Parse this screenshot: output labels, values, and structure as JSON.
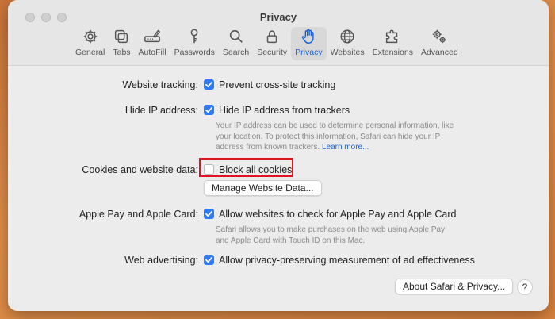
{
  "window": {
    "title": "Privacy"
  },
  "toolbar": {
    "tabs": [
      {
        "label": "General",
        "icon": "gear-icon"
      },
      {
        "label": "Tabs",
        "icon": "tabs-icon"
      },
      {
        "label": "AutoFill",
        "icon": "pencil-icon"
      },
      {
        "label": "Passwords",
        "icon": "key-icon"
      },
      {
        "label": "Search",
        "icon": "search-icon"
      },
      {
        "label": "Security",
        "icon": "lock-icon"
      },
      {
        "label": "Privacy",
        "icon": "hand-icon",
        "active": true
      },
      {
        "label": "Websites",
        "icon": "globe-icon"
      },
      {
        "label": "Extensions",
        "icon": "puzzle-icon"
      },
      {
        "label": "Advanced",
        "icon": "gears-icon"
      }
    ]
  },
  "settings": {
    "tracking": {
      "label": "Website tracking:",
      "option": "Prevent cross-site tracking",
      "checked": true
    },
    "hide_ip": {
      "label": "Hide IP address:",
      "option": "Hide IP address from trackers",
      "checked": true,
      "desc_line1": "Your IP address can be used to determine personal information, like",
      "desc_line2": "your location. To protect this information, Safari can hide your IP",
      "desc_line3": "address from known trackers.",
      "learn_more": "Learn more..."
    },
    "cookies": {
      "label": "Cookies and website data:",
      "option": "Block all cookies",
      "checked": false,
      "manage_button": "Manage Website Data..."
    },
    "apple_pay": {
      "label": "Apple Pay and Apple Card:",
      "option": "Allow websites to check for Apple Pay and Apple Card",
      "checked": true,
      "desc_line1": "Safari allows you to make purchases on the web using Apple Pay",
      "desc_line2": "and Apple Card with Touch ID on this Mac."
    },
    "advertising": {
      "label": "Web advertising:",
      "option": "Allow privacy-preserving measurement of ad effectiveness",
      "checked": true
    }
  },
  "footer": {
    "about_button": "About Safari & Privacy...",
    "help_button": "?"
  },
  "colors": {
    "accent": "#2f7bf5",
    "highlight": "#e1141e",
    "active_tab": "#1a63d6"
  }
}
